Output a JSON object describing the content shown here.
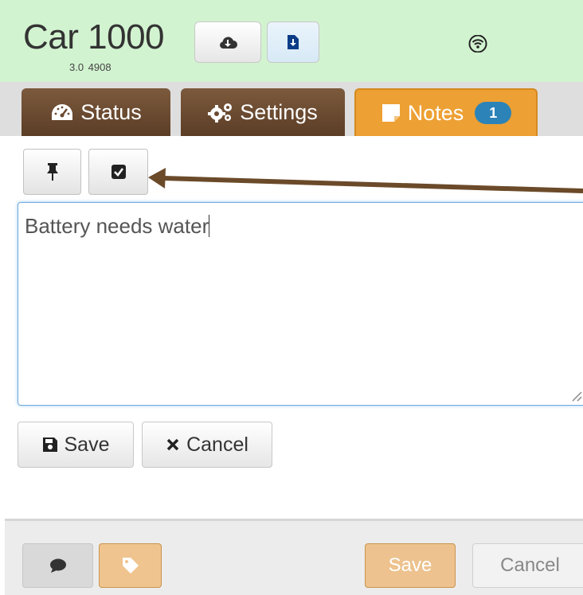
{
  "header": {
    "title": "Car 1000",
    "version": "3.0  4908",
    "buttons": [
      {
        "icon": "cloud-download-icon"
      },
      {
        "icon": "file-download-icon"
      }
    ],
    "status_icon": "wifi-icon"
  },
  "tabs": [
    {
      "label": "Status",
      "icon": "dashboard-icon",
      "active": false
    },
    {
      "label": "Settings",
      "icon": "gears-icon",
      "active": false
    },
    {
      "label": "Notes",
      "icon": "note-icon",
      "active": true,
      "badge": "1"
    }
  ],
  "notes": {
    "toolbar": [
      {
        "icon": "pin-icon"
      },
      {
        "icon": "checkbox-icon"
      }
    ],
    "text": "Battery needs water",
    "save_label": "Save",
    "cancel_label": "Cancel"
  },
  "footer": {
    "save_label": "Save",
    "cancel_label": "Cancel"
  },
  "colors": {
    "header_bg": "#d2f3d0",
    "tab_brown": "#6b4a31",
    "tab_active": "#eda033",
    "badge": "#2b83b8",
    "annotation_arrow": "#6b4a2a"
  }
}
